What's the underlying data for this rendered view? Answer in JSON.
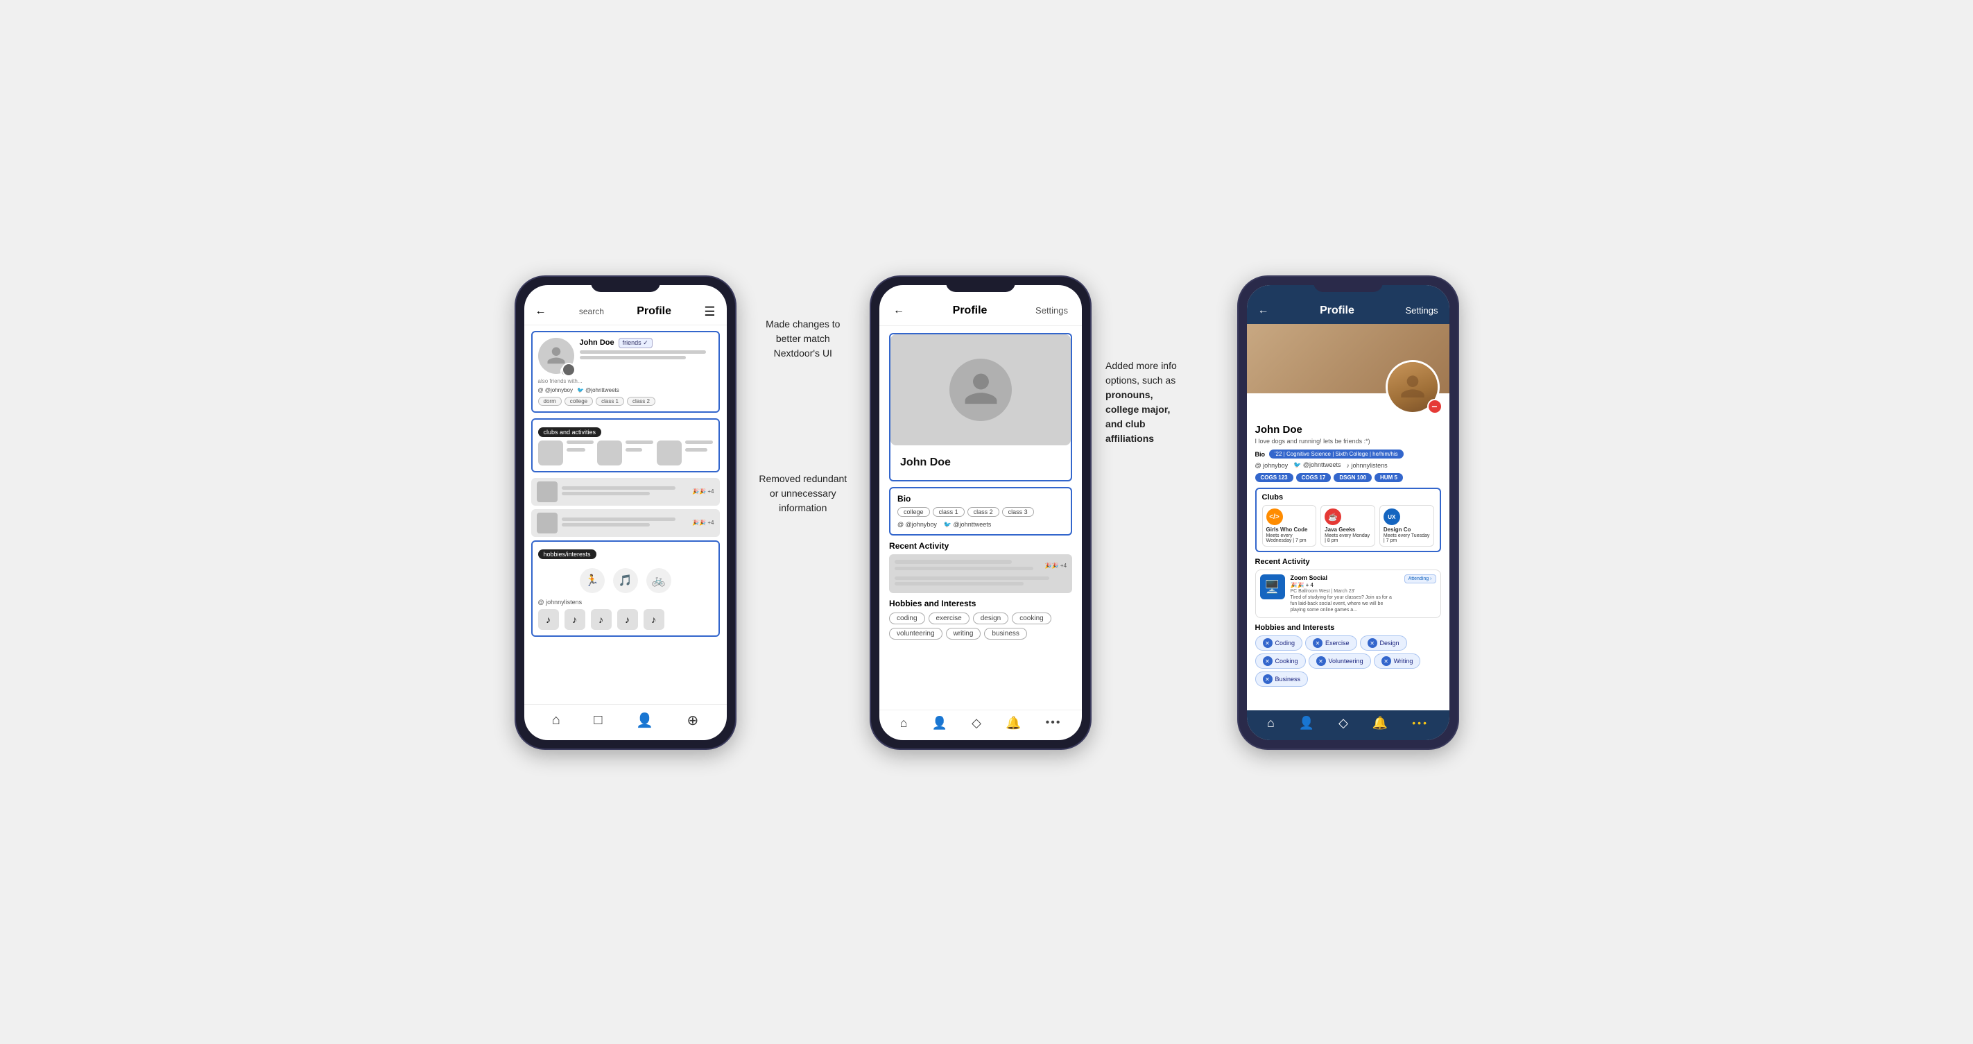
{
  "page": {
    "bg": "#f0f0f0"
  },
  "phone1": {
    "header": {
      "back": "←",
      "search": "search",
      "title": "Profile",
      "menu": "☰"
    },
    "profile": {
      "name": "John Doe",
      "badge": "friends ✓",
      "also_friends": "also friends with...",
      "social1": "@ @johnyboy",
      "social2": "🐦 @johnttweets",
      "tags": [
        "dorm",
        "college",
        "class 1",
        "class 2"
      ]
    },
    "clubs_label": "clubs and activities",
    "hobbies_label": "hobbies/interests",
    "spotify": "@ johnnylistens",
    "nav": [
      "⌂",
      "□",
      "👤",
      "⊕"
    ]
  },
  "phone2": {
    "header": {
      "back": "←",
      "title": "Profile",
      "settings": "Settings"
    },
    "profile_name": "John Doe",
    "bio": {
      "label": "Bio",
      "tags": [
        "college",
        "class 1",
        "class 2",
        "class 3"
      ],
      "social1": "@ @johnyboy",
      "social2": "🐦 @johnttweets"
    },
    "recent_label": "Recent Activity",
    "hobbies_label": "Hobbies and Interests",
    "hobbies": [
      "coding",
      "exercise",
      "design",
      "cooking",
      "volunteering",
      "writing",
      "business"
    ],
    "nav": [
      "⌂",
      "👤",
      "◇",
      "🔔",
      "•••"
    ]
  },
  "phone3": {
    "header": {
      "back": "←",
      "title": "Profile",
      "settings": "Settings"
    },
    "profile_name": "John Doe",
    "profile_bio": "I love dogs and running! lets be friends :*)",
    "bio_pill": "'22 | Cognitive Science | Sixth College | he/him/his",
    "social1": "@ johnyboy",
    "social2": "🐦 @johnttweets",
    "social3": "♪ johnnylistens",
    "courses": [
      "COGS 123",
      "COGS 17",
      "DSGN 100",
      "HUM 5"
    ],
    "clubs_label": "Clubs",
    "clubs": [
      {
        "name": "Girls Who Code",
        "icon": "</>",
        "color": "#ff8c00",
        "meet": "Meets every Wednesday | 7 pm"
      },
      {
        "name": "Java Geeks",
        "icon": "☕",
        "color": "#e53935",
        "meet": "Meets every Monday | 8 pm"
      },
      {
        "name": "Design Co",
        "icon": "UX",
        "color": "#1565c0",
        "meet": "Meets every Tuesday | 7 pm"
      }
    ],
    "recent_label": "Recent Activity",
    "activity": {
      "title": "Zoom Social",
      "emoji": "🎉🎉 + 4",
      "location": "PC Ballroom West | March 23'",
      "desc": "Tired of studying for your classes? Join us for a fun laid-back social event, where we will be playing some online games a...",
      "status": "Attending"
    },
    "hobbies_label": "Hobbies and Interests",
    "hobbies": [
      "Coding",
      "Exercise",
      "Design",
      "Cooking",
      "Volunteering",
      "Writing",
      "Business"
    ],
    "nav": [
      "⌂",
      "👤",
      "◇",
      "🔔",
      "•••"
    ]
  },
  "annotations": {
    "ann1": {
      "line1": "Made changes to",
      "line2": "better match",
      "line3": "Nextdoor's UI"
    },
    "ann2": {
      "line1": "Removed redundant",
      "line2": "or unnecessary",
      "line3": "information"
    },
    "ann3": {
      "line1": "Added more info",
      "line2": "options, such as",
      "line3": "pronouns,",
      "line4": "college major,",
      "line5": "and club",
      "line6": "affiliations"
    }
  }
}
